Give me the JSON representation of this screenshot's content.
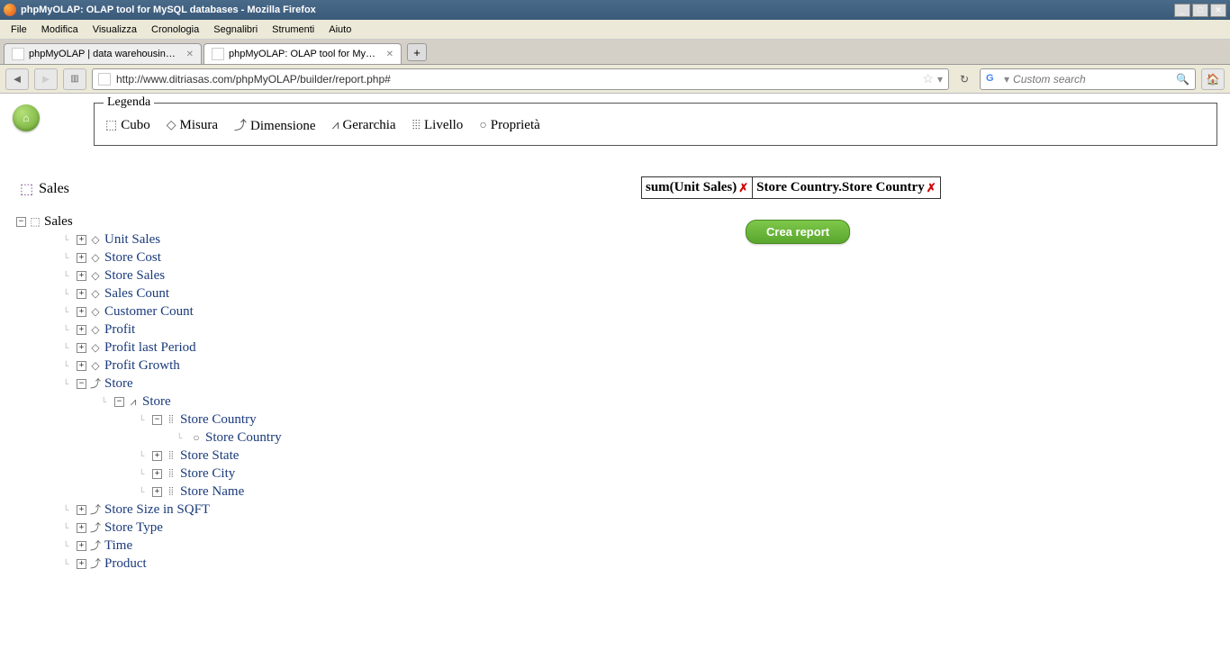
{
  "window": {
    "title": "phpMyOLAP: OLAP tool for MySQL databases - Mozilla Firefox"
  },
  "menu": {
    "items": [
      "File",
      "Modifica",
      "Visualizza",
      "Cronologia",
      "Segnalibri",
      "Strumenti",
      "Aiuto"
    ]
  },
  "tabs": [
    {
      "label": "phpMyOLAP | data warehousing e analisi ...",
      "active": false
    },
    {
      "label": "phpMyOLAP: OLAP tool for MySQL datab...",
      "active": true
    }
  ],
  "urlbar": {
    "url": "http://www.ditriasas.com/phpMyOLAP/builder/report.php#"
  },
  "searchbar": {
    "placeholder": "Custom search"
  },
  "legend": {
    "title": "Legenda",
    "items": [
      {
        "icon": "cube",
        "label": "Cubo"
      },
      {
        "icon": "measure",
        "label": "Misura"
      },
      {
        "icon": "dimension",
        "label": "Dimensione"
      },
      {
        "icon": "hierarchy",
        "label": "Gerarchia"
      },
      {
        "icon": "level",
        "label": "Livello"
      },
      {
        "icon": "property",
        "label": "Proprietà"
      }
    ]
  },
  "cube": {
    "name": "Sales"
  },
  "tree": {
    "root": "Sales",
    "measures": [
      "Unit Sales",
      "Store Cost",
      "Store Sales",
      "Sales Count",
      "Customer Count",
      "Profit",
      "Profit last Period",
      "Profit Growth"
    ],
    "store_dim": {
      "label": "Store",
      "hierarchy": "Store",
      "levels": [
        "Store Country",
        "Store State",
        "Store City",
        "Store Name"
      ],
      "expanded_level": "Store Country",
      "property": "Store Country"
    },
    "other_dims": [
      "Store Size in SQFT",
      "Store Type",
      "Time",
      "Product"
    ]
  },
  "drop": {
    "measure": "sum(Unit Sales)",
    "dimension": "Store Country.Store Country"
  },
  "button": {
    "create": "Crea report"
  }
}
